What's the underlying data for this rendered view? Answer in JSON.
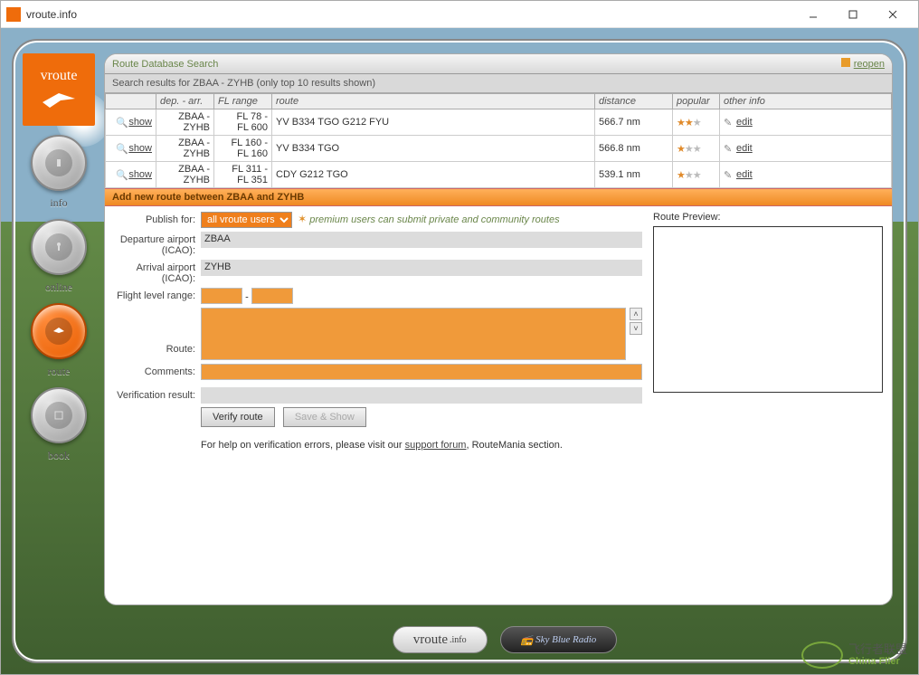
{
  "window": {
    "title": "vroute.info"
  },
  "nav": {
    "logo_text": "vroute",
    "items": [
      {
        "label": "info",
        "active": false
      },
      {
        "label": "online",
        "active": false
      },
      {
        "label": "route",
        "active": true
      },
      {
        "label": "book",
        "active": false
      }
    ]
  },
  "header": {
    "title": "Route Database Search",
    "reopen": "reopen",
    "subtitle": "Search results for ZBAA - ZYHB (only top 10 results shown)"
  },
  "table": {
    "columns": [
      "",
      "dep. - arr.",
      "FL range",
      "route",
      "distance",
      "popular",
      "other info"
    ],
    "show_label": "show",
    "edit_label": "edit",
    "rows": [
      {
        "dep": "ZBAA -",
        "arr": "ZYHB",
        "fl1": "FL 78 -",
        "fl2": "FL 600",
        "route": "YV B334 TGO G212 FYU",
        "distance": "566.7 nm",
        "stars": 2
      },
      {
        "dep": "ZBAA -",
        "arr": "ZYHB",
        "fl1": "FL 160 -",
        "fl2": "FL 160",
        "route": "YV B334 TGO",
        "distance": "566.8 nm",
        "stars": 1
      },
      {
        "dep": "ZBAA -",
        "arr": "ZYHB",
        "fl1": "FL 311 -",
        "fl2": "FL 351",
        "route": "CDY G212 TGO",
        "distance": "539.1 nm",
        "stars": 1
      }
    ]
  },
  "add_section": {
    "title": "Add new route between ZBAA and ZYHB"
  },
  "form": {
    "publish_label": "Publish for:",
    "publish_value": "all vroute users",
    "premium_note": "premium users can submit private and community routes",
    "departure_label": "Departure airport (ICAO):",
    "departure_value": "ZBAA",
    "arrival_label": "Arrival airport (ICAO):",
    "arrival_value": "ZYHB",
    "fl_label": "Flight level range:",
    "fl_sep": "-",
    "route_label": "Route:",
    "comments_label": "Comments:",
    "verification_label": "Verification result:",
    "verify_btn": "Verify route",
    "save_btn": "Save & Show",
    "help_prefix": "For help on verification errors, please visit our ",
    "help_link": "support forum",
    "help_suffix": ", RouteMania section.",
    "preview_label": "Route Preview:"
  },
  "footer": {
    "brand_main": "vroute",
    "brand_sub": ".info",
    "dark_text": "Sky Blue Radio"
  },
  "watermark": {
    "cn": "飞行者联盟",
    "en": "China Flier"
  }
}
